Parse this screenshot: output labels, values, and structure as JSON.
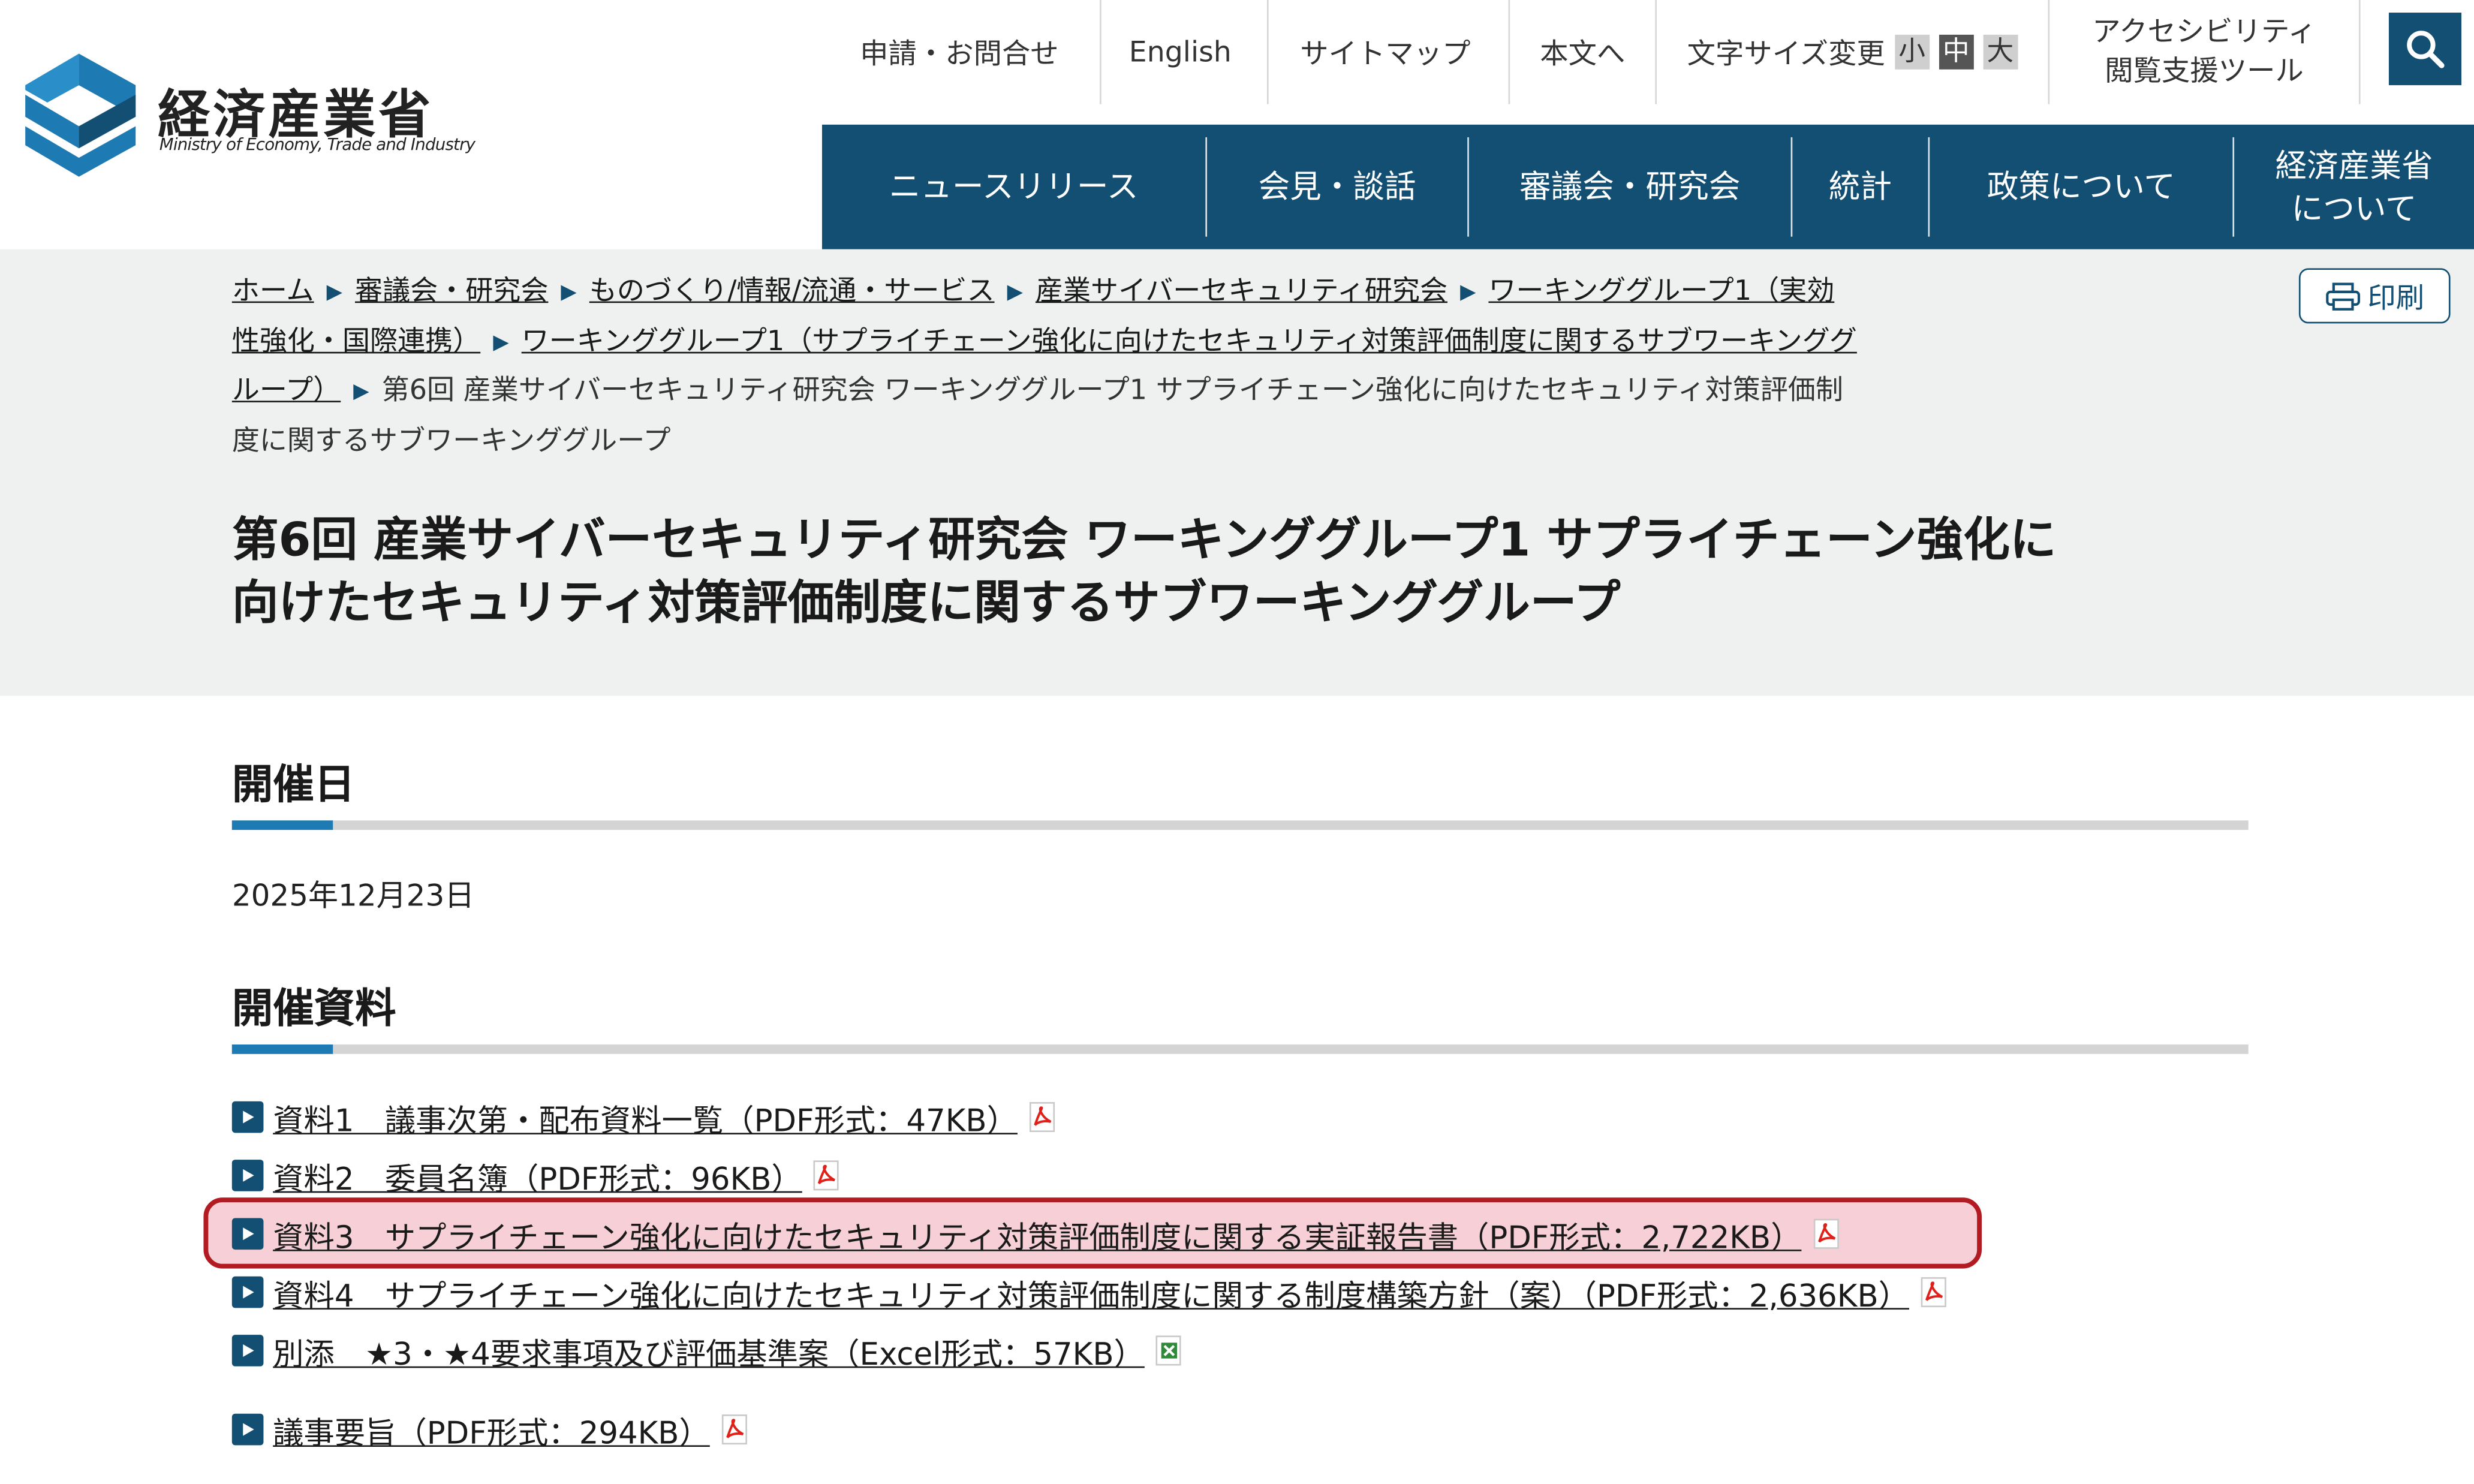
{
  "header": {
    "logo_title": "経済産業省",
    "logo_subtitle": "Ministry of Economy, Trade and Industry",
    "utility": {
      "contact": "申請・お問合せ",
      "english": "English",
      "sitemap": "サイトマップ",
      "skip_to_content": "本文へ",
      "font_size_label": "文字サイズ変更",
      "font_small": "小",
      "font_medium": "中",
      "font_large": "大",
      "accessibility_line1": "アクセシビリティ",
      "accessibility_line2": "閲覧支援ツール",
      "search_icon": "search-icon"
    }
  },
  "nav": {
    "items": [
      {
        "label": "ニュースリリース"
      },
      {
        "label": "会見・談話"
      },
      {
        "label": "審議会・研究会"
      },
      {
        "label": "統計"
      },
      {
        "label": "政策について"
      },
      {
        "label_line1": "経済産業省",
        "label_line2": "について"
      }
    ]
  },
  "breadcrumb": {
    "items": [
      "ホーム",
      "審議会・研究会",
      "ものづくり/情報/流通・サービス",
      "産業サイバーセキュリティ研究会",
      "ワーキンググループ1（実効性強化・国際連携）",
      "ワーキンググループ1（サプライチェーン強化に向けたセキュリティ対策評価制度に関するサブワーキンググループ）"
    ],
    "current": "第6回 産業サイバーセキュリティ研究会 ワーキンググループ1 サプライチェーン強化に向けたセキュリティ対策評価制度に関するサブワーキンググループ"
  },
  "print_label": "印刷",
  "page": {
    "title_line1": "第6回 産業サイバーセキュリティ研究会 ワーキンググループ1 サプライチェーン強化に",
    "title_line2": "向けたセキュリティ対策評価制度に関するサブワーキンググループ"
  },
  "meeting": {
    "date_heading": "開催日",
    "date": "2025年12月23日",
    "materials_heading": "開催資料",
    "documents": [
      {
        "label": "資料1　議事次第・配布資料一覧（PDF形式：47KB）",
        "type": "pdf"
      },
      {
        "label": "資料2　委員名簿（PDF形式：96KB）",
        "type": "pdf"
      },
      {
        "label": "資料3　サプライチェーン強化に向けたセキュリティ対策評価制度に関する実証報告書（PDF形式：2,722KB）",
        "type": "pdf",
        "highlighted": true
      },
      {
        "label": "資料4　サプライチェーン強化に向けたセキュリティ対策評価制度に関する制度構築方針（案）（PDF形式：2,636KB）",
        "type": "pdf"
      },
      {
        "label": "別添　★3・★4要求事項及び評価基準案（Excel形式：57KB）",
        "type": "excel"
      }
    ],
    "summary": {
      "label": "議事要旨（PDF形式：294KB）",
      "type": "pdf"
    }
  },
  "colors": {
    "brand_navy": "#134f72",
    "accent_blue": "#1d7ab2",
    "highlight_border": "#b31b22",
    "highlight_fill": "#f6d0d6",
    "band_bg": "#eef1f0"
  }
}
